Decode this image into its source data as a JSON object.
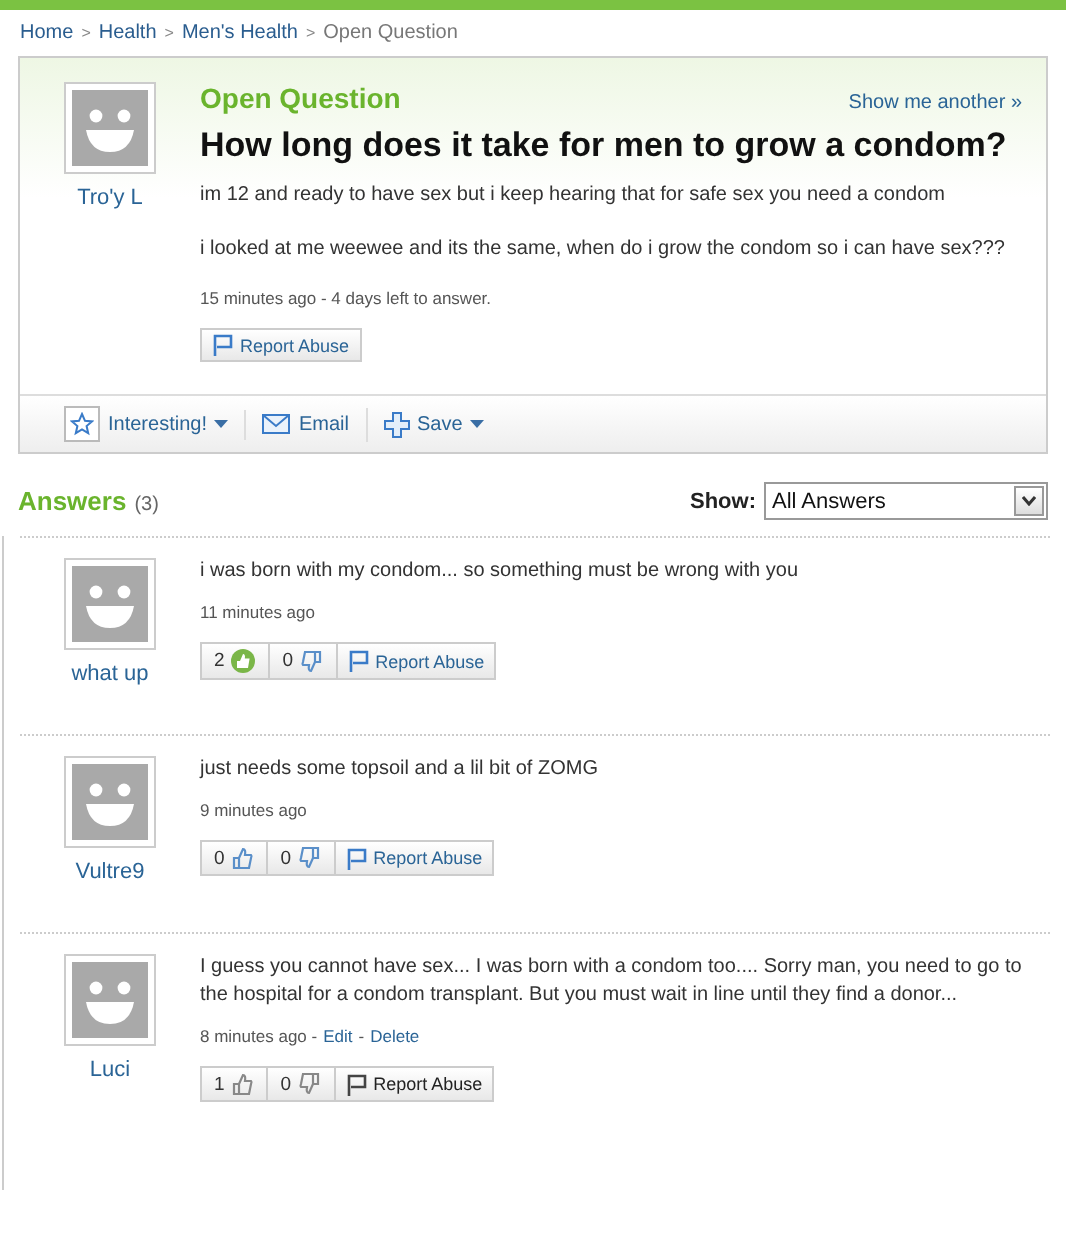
{
  "breadcrumb": [
    {
      "kind": "link",
      "label": "Home"
    },
    {
      "kind": "separator",
      "label": ">"
    },
    {
      "kind": "link",
      "label": "Health"
    },
    {
      "kind": "separator",
      "label": ">"
    },
    {
      "kind": "link",
      "label": "Men's Health"
    },
    {
      "kind": "separator",
      "label": ">"
    },
    {
      "kind": "current",
      "label": "Open Question"
    }
  ],
  "question": {
    "status": "Open Question",
    "show_another": "Show me another »",
    "asker": "Tro'y L",
    "title": "How long does it take for men to grow a condom?",
    "paragraphs": [
      "im 12 and ready to have sex but i keep hearing that for safe sex you need a condom",
      "i looked at me weewee and its the same, when do i grow the condom so i can have sex???"
    ],
    "meta": "15 minutes ago - 4 days left to answer.",
    "report": "Report Abuse"
  },
  "toolbar": [
    {
      "kind": "star",
      "label": "Interesting!",
      "menu": true
    },
    {
      "kind": "mail",
      "label": "Email",
      "menu": false
    },
    {
      "kind": "plus",
      "label": "Save",
      "menu": true
    }
  ],
  "answers_header": {
    "title": "Answers",
    "count": "(3)",
    "show_label": "Show:",
    "show_value": "All Answers"
  },
  "answers": [
    {
      "author": "what up",
      "text": "i was born with my condom... so something must be wrong with you",
      "meta": [
        {
          "kind": "text",
          "label": "11 minutes ago"
        }
      ],
      "thumbs_up": "2",
      "thumbs_down": "0",
      "kind": "voted",
      "report": "Report Abuse"
    },
    {
      "author": "Vultre9",
      "text": "just needs some topsoil and a lil bit of ZOMG",
      "meta": [
        {
          "kind": "text",
          "label": "9 minutes ago"
        }
      ],
      "thumbs_up": "0",
      "thumbs_down": "0",
      "kind": "votable",
      "report": "Report Abuse"
    },
    {
      "author": "Luci",
      "text": "I guess you cannot have sex... I was born with a condom too.... Sorry man, you need to go to the hospital for a condom transplant. But you must wait in line until they find a donor...",
      "meta": [
        {
          "kind": "text",
          "label": "8 minutes ago -"
        },
        {
          "kind": "link",
          "label": "Edit"
        },
        {
          "kind": "text",
          "label": "-"
        },
        {
          "kind": "link",
          "label": "Delete"
        }
      ],
      "thumbs_up": "1",
      "thumbs_down": "0",
      "kind": "own",
      "report": "Report Abuse"
    }
  ]
}
